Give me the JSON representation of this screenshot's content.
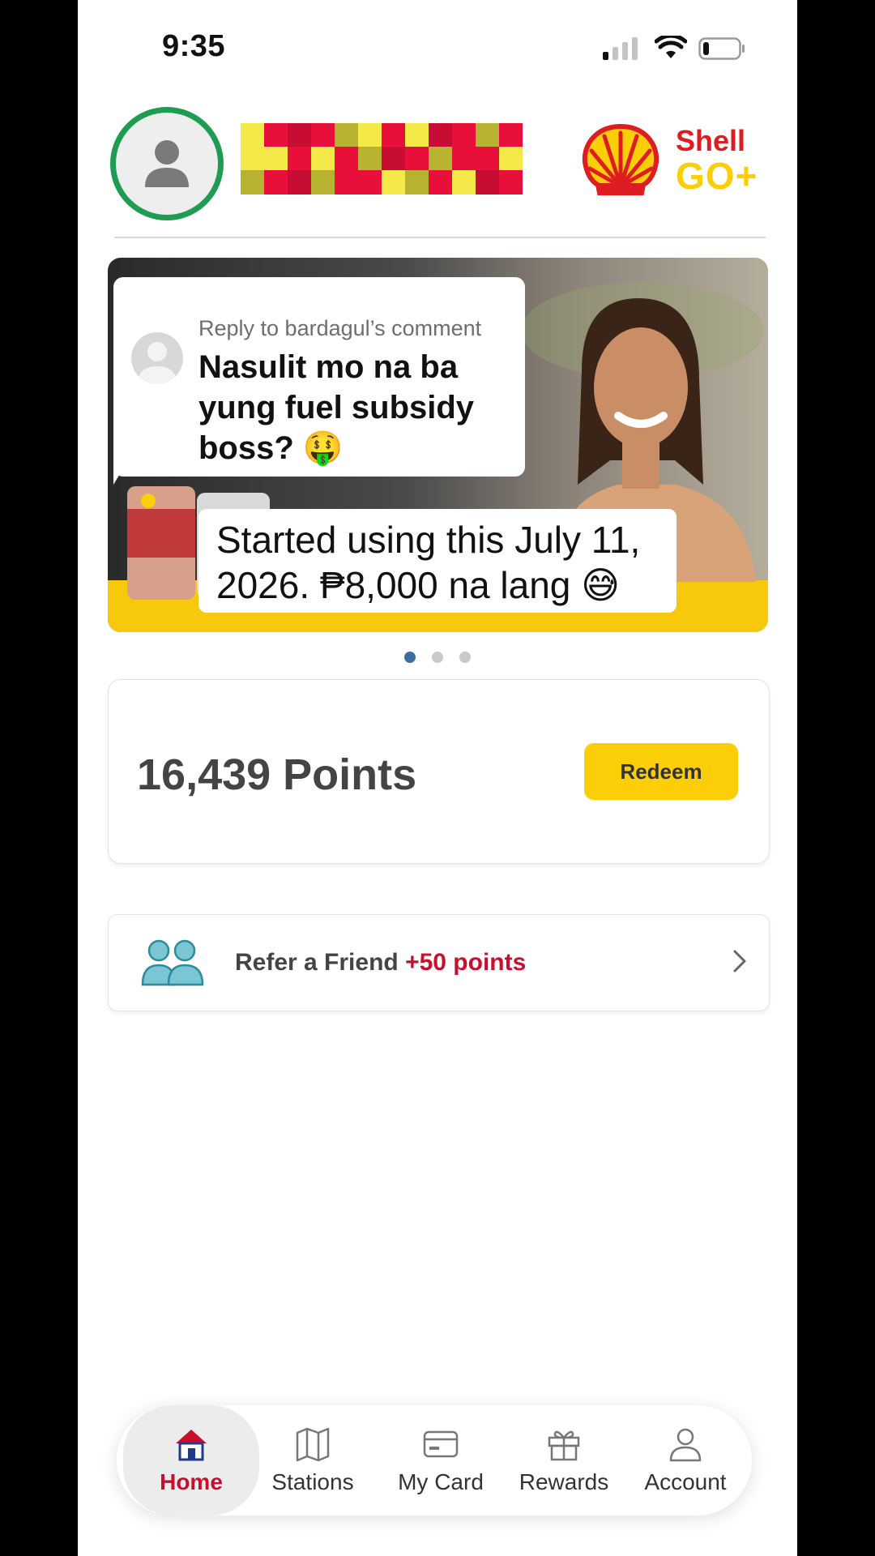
{
  "status_bar": {
    "time": "9:35"
  },
  "header": {
    "brand_shell": "Shell",
    "brand_go": "GO+"
  },
  "banner": {
    "comment_reply": "Reply to bardagul’s comment",
    "comment_text": "Nasulit mo na ba yung fuel subsidy boss? 🤑",
    "caption": "Started using this July 11, 2026. ₱8,000 na lang 😅",
    "slides_total": 3,
    "active_slide": 1
  },
  "points": {
    "value_label": "16,439 Points",
    "redeem_label": "Redeem"
  },
  "referral": {
    "label": "Refer a Friend",
    "points_label": "+50 points"
  },
  "nav": {
    "home": "Home",
    "stations": "Stations",
    "my_card": "My Card",
    "rewards": "Rewards",
    "account": "Account"
  },
  "colors": {
    "shell_red": "#dd1d21",
    "shell_yellow": "#fbce07",
    "avatar_ring": "#1e9c52",
    "active_dot": "#3a6ea5"
  }
}
